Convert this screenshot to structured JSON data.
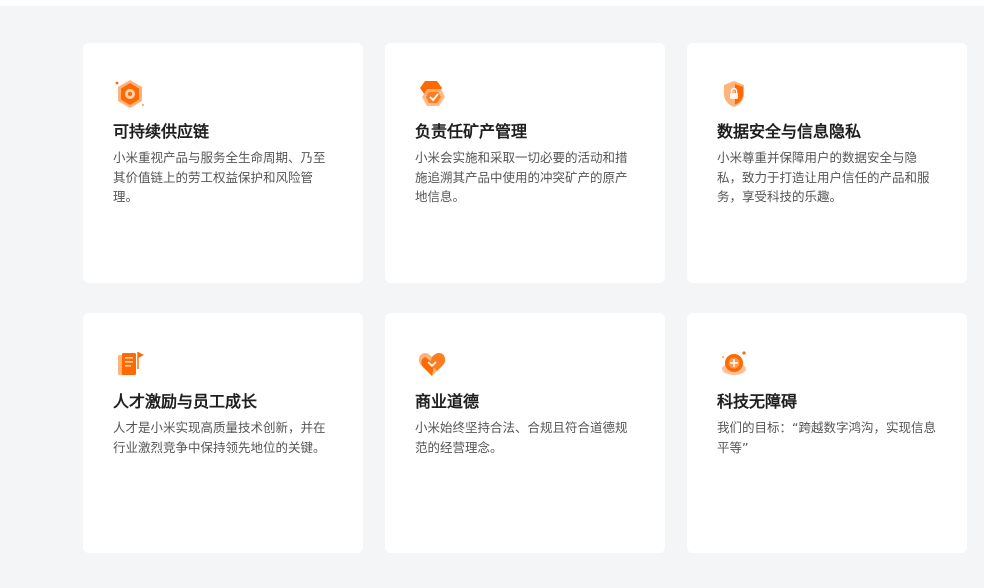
{
  "colors": {
    "accent": "#ff6a00",
    "accent_light": "#ffb27a",
    "background": "#f4f5f7",
    "card": "#ffffff"
  },
  "cards": [
    {
      "icon": "supply-chain-icon",
      "title": "可持续供应链",
      "description": "小米重视产品与服务全生命周期、乃至其价值链上的劳工权益保护和风险管理。"
    },
    {
      "icon": "mineral-icon",
      "title": "负责任矿产管理",
      "description": "小米会实施和采取一切必要的活动和措施追溯其产品中使用的冲突矿产的原产地信息。"
    },
    {
      "icon": "shield-lock-icon",
      "title": "数据安全与信息隐私",
      "description": "小米尊重并保障用户的数据安全与隐私，致力于打造让用户信任的产品和服务，享受科技的乐趣。"
    },
    {
      "icon": "talent-flag-icon",
      "title": "人才激励与员工成长",
      "description": "人才是小米实现高质量技术创新，并在行业激烈竞争中保持领先地位的关键。"
    },
    {
      "icon": "heart-handshake-icon",
      "title": "商业道德",
      "description": "小米始终坚持合法、合规且符合道德规范的经营理念。"
    },
    {
      "icon": "accessibility-icon",
      "title": "科技无障碍",
      "description": "我们的目标：“跨越数字鸿沟，实现信息平等”"
    }
  ]
}
